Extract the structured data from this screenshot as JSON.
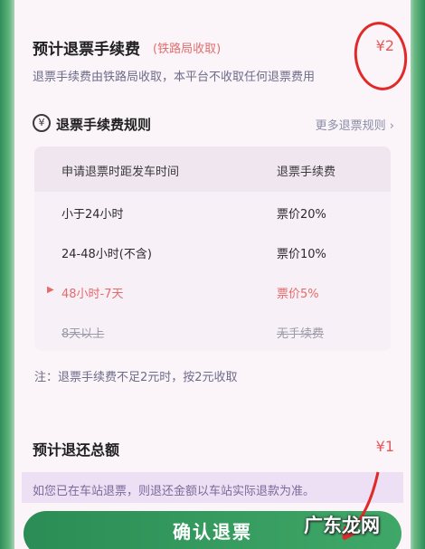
{
  "fee_section": {
    "title": "预计退票手续费",
    "source_tag": "(铁路局收取)",
    "amount": "¥2",
    "note": "退票手续费由铁路局收取，本平台不收取任何退票费用"
  },
  "rules_section": {
    "icon": "yen-coin-icon",
    "icon_glyph": "¥",
    "title": "退票手续费规则",
    "more_link": "更多退票规则 ›",
    "table": {
      "headers": [
        "申请退票时距发车时间",
        "退票手续费"
      ],
      "rows": [
        {
          "time": "小于24小时",
          "fee": "票价20%",
          "state": "normal"
        },
        {
          "time": "24-48小时(不含)",
          "fee": "票价10%",
          "state": "normal"
        },
        {
          "time": "48小时-7天",
          "fee": "票价5%",
          "state": "current"
        },
        {
          "time": "8天以上",
          "fee": "无手续费",
          "state": "struck"
        }
      ]
    },
    "note": "注：退票手续费不足2元时，按2元收取"
  },
  "total_section": {
    "label": "预计退还总额",
    "amount": "¥1",
    "station_notice": "如您已在车站退票，则退还金额以车站实际退款为准。"
  },
  "confirm_button": "确认退票",
  "watermark": "广东龙网",
  "colors": {
    "accent_green": "#2b8d55",
    "price_red": "#e25a5a",
    "annotation_red": "#e02a2a"
  }
}
